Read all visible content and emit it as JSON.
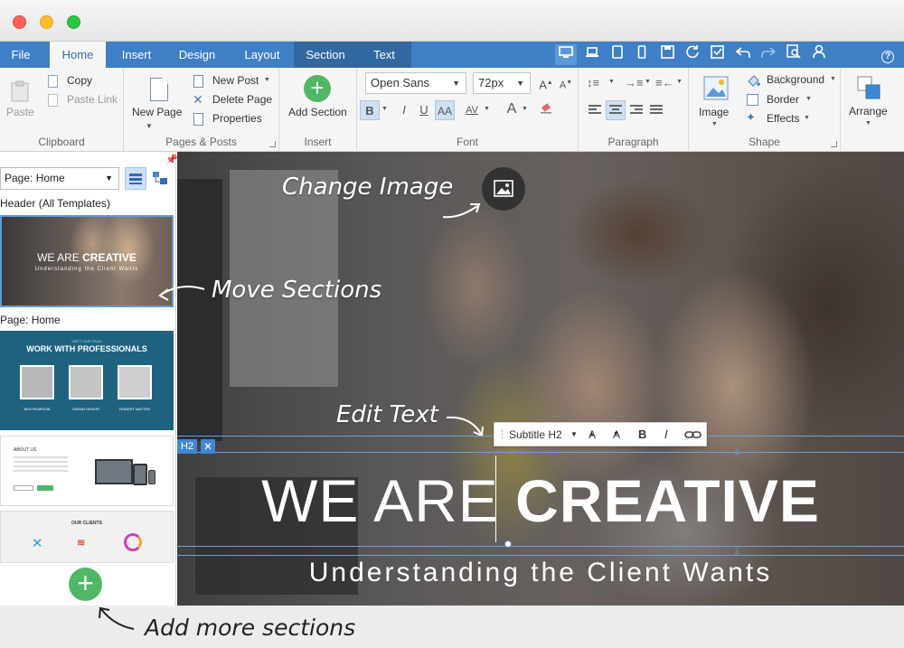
{
  "window": {
    "colors": {
      "close": "#fc5f57",
      "minimize": "#fdbc2e",
      "zoom": "#29c83f"
    }
  },
  "tabs": [
    "File",
    "Home",
    "Insert",
    "Design",
    "Layout",
    "Section",
    "Text"
  ],
  "active_tab": "Home",
  "quick_access": [
    "desktop-icon",
    "laptop-icon",
    "tablet-icon",
    "phone-icon",
    "save-icon",
    "refresh-icon",
    "check-icon",
    "undo-icon",
    "redo-icon",
    "preview-icon",
    "user-icon"
  ],
  "help_label": "?",
  "ribbon": {
    "clipboard": {
      "label": "Clipboard",
      "paste": "Paste",
      "copy": "Copy",
      "paste_link": "Paste Link"
    },
    "pages": {
      "label": "Pages & Posts",
      "new_page": "New Page",
      "new_post": "New Post",
      "delete_page": "Delete Page",
      "properties": "Properties"
    },
    "insert": {
      "label": "Insert",
      "add_section": "Add Section"
    },
    "font": {
      "label": "Font",
      "family": "Open Sans",
      "size": "72px",
      "bold": "B",
      "italic": "I",
      "underline": "U",
      "caps": "AA",
      "spacing": "AV",
      "color": "A"
    },
    "paragraph": {
      "label": "Paragraph"
    },
    "shape": {
      "label": "Shape",
      "image": "Image",
      "background": "Background",
      "border": "Border",
      "effects": "Effects"
    },
    "arrange": {
      "label": "Arrange"
    }
  },
  "sidebar": {
    "page_select": "Page: Home",
    "header_label": "Header (All Templates)",
    "page_label": "Page: Home",
    "thumb_header": {
      "title_thin": "WE ARE",
      "title_bold": "CREATIVE",
      "subtitle": "Understanding the Client Wants"
    },
    "thumb_pros": {
      "kicker": "MEET OUR TEAM",
      "title": "WORK WITH PROFESSIONALS",
      "names": [
        "BEN PEARSON",
        "CERAN HONOR",
        "ROBERT MATTER"
      ]
    },
    "thumb_about": {
      "title": "ABOUT US"
    },
    "thumb_clients": {
      "title": "OUR CLIENTS"
    }
  },
  "canvas": {
    "h2_tag": "H2",
    "h2_close": "✕",
    "toolbar": {
      "style": "Subtitle H2",
      "grow": "A",
      "shrink": "A",
      "bold": "B",
      "italic": "I",
      "link": "link-icon"
    },
    "headline_thin": "WE ARE",
    "headline_bold": "CREATIVE",
    "subtitle": "Understanding the Client Wants"
  },
  "annotations": {
    "change_image": "Change Image",
    "move_sections": "Move Sections",
    "edit_text": "Edit Text",
    "add_more": "Add more sections"
  },
  "add_section_glyph": "+",
  "accent": "#3f7fc6",
  "add_green": "#4fb766"
}
